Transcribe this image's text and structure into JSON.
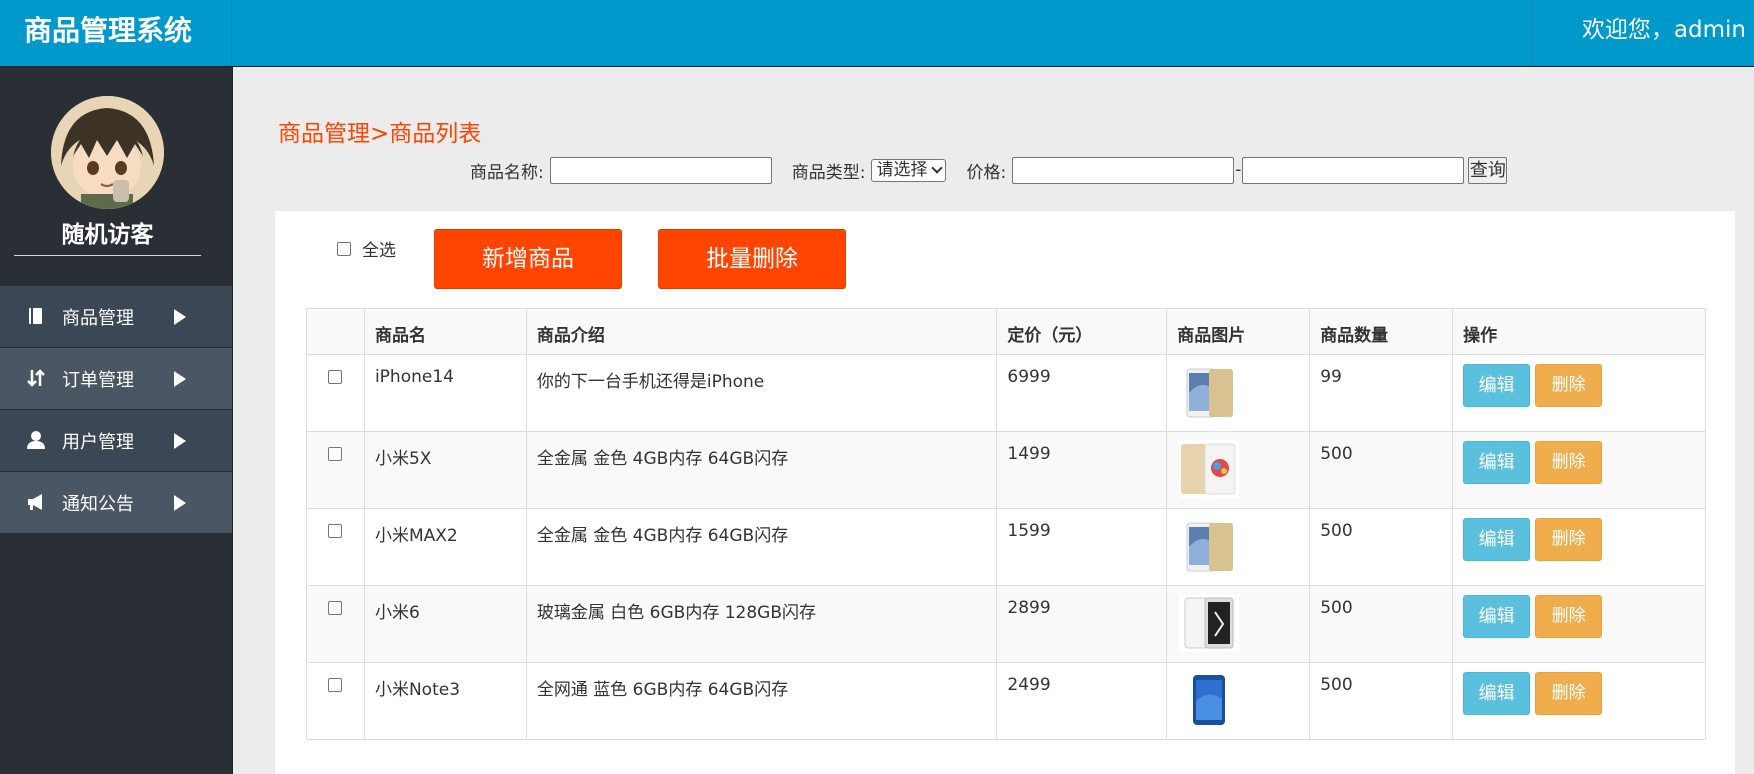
{
  "header": {
    "brand": "商品管理系统",
    "welcome": "欢迎您，admin"
  },
  "sidebar": {
    "username": "随机访客",
    "items": [
      {
        "label": "商品管理",
        "icon": "book-icon"
      },
      {
        "label": "订单管理",
        "icon": "sort-arrows-icon"
      },
      {
        "label": "用户管理",
        "icon": "user-icon"
      },
      {
        "label": "通知公告",
        "icon": "megaphone-icon"
      }
    ]
  },
  "main": {
    "breadcrumb": "商品管理>商品列表",
    "filters": {
      "name_label": "商品名称:",
      "type_label": "商品类型:",
      "type_selected": "请选择",
      "price_label": "价格:",
      "price_dash": "-",
      "search_label": "查询"
    },
    "select_all_label": "全选",
    "add_label": "新增商品",
    "batch_delete_label": "批量删除",
    "table": {
      "headers": [
        "",
        "商品名",
        "商品介绍",
        "定价（元）",
        "商品图片",
        "商品数量",
        "操作"
      ],
      "rows": [
        {
          "name": "iPhone14",
          "desc": "你的下一台手机还得是iPhone",
          "price": "6999",
          "qty": "99"
        },
        {
          "name": "小米5X",
          "desc": "全金属 金色 4GB内存 64GB闪存",
          "price": "1499",
          "qty": "500"
        },
        {
          "name": "小米MAX2",
          "desc": "全金属 金色 4GB内存 64GB闪存",
          "price": "1599",
          "qty": "500"
        },
        {
          "name": "小米6",
          "desc": "玻璃金属 白色 6GB内存 128GB闪存",
          "price": "2899",
          "qty": "500"
        },
        {
          "name": "小米Note3",
          "desc": "全网通 蓝色 6GB内存 64GB闪存",
          "price": "2499",
          "qty": "500"
        }
      ],
      "edit_label": "编辑",
      "delete_label": "删除"
    }
  },
  "colors": {
    "header": "#0099cc",
    "sidebar": "#2a2f36",
    "accent": "#ff4500",
    "edit": "#5bc0de",
    "delete": "#f0ad4e"
  }
}
